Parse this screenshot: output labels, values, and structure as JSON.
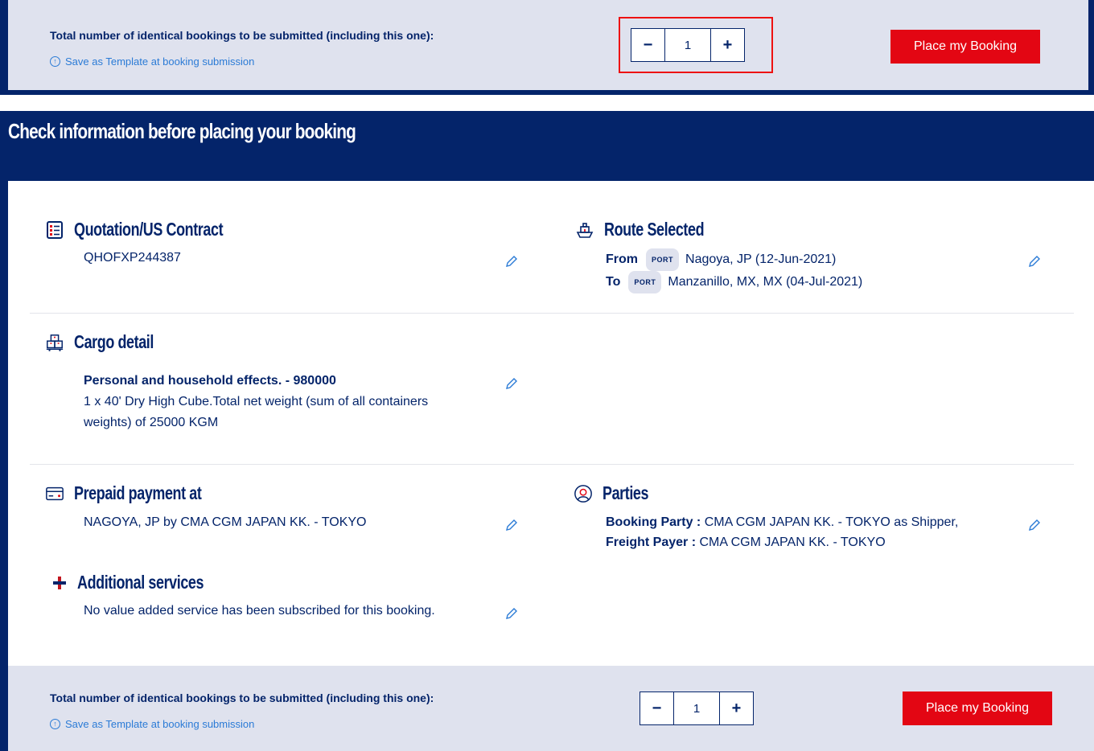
{
  "top_bar": {
    "total_label": "Total number of identical bookings to be submitted (including this one):",
    "save_template": "Save as Template at booking submission",
    "quantity": "1",
    "minus": "−",
    "plus": "+",
    "place_booking": "Place my Booking"
  },
  "check": {
    "header": "Check information before placing your booking"
  },
  "quotation": {
    "title": "Quotation/US Contract",
    "value": "QHOFXP244387"
  },
  "route": {
    "title": "Route Selected",
    "from_label": "From",
    "from_tag": "PORT",
    "from_value": "Nagoya, JP (12-Jun-2021)",
    "to_label": "To",
    "to_tag": "PORT",
    "to_value": "Manzanillo, MX, MX (04-Jul-2021)"
  },
  "cargo": {
    "title": "Cargo detail",
    "commodity": "Personal and household effects. - 980000",
    "line1": "1 x 40' Dry High Cube.Total net weight (sum of all containers",
    "line2": "weights) of 25000 KGM"
  },
  "payment": {
    "title": "Prepaid payment at",
    "value": "NAGOYA, JP by CMA CGM JAPAN KK. - TOKYO"
  },
  "parties": {
    "title": "Parties",
    "booking_label": "Booking Party :",
    "booking_value": "CMA CGM JAPAN KK. - TOKYO as Shipper,",
    "freight_label": "Freight Payer :",
    "freight_value": "CMA CGM JAPAN KK. - TOKYO"
  },
  "additional": {
    "title": "Additional services",
    "value": "No value added service has been subscribed for this booking."
  },
  "bottom_bar": {
    "total_label": "Total number of identical bookings to be submitted (including this one):",
    "save_template": "Save as Template at booking submission",
    "quantity": "1",
    "minus": "−",
    "plus": "+",
    "place_booking": "Place my Booking"
  },
  "colors": {
    "navy": "#04246a",
    "red": "#e30613",
    "link": "#2b7bd6",
    "bar_bg": "#dfe2ee"
  }
}
